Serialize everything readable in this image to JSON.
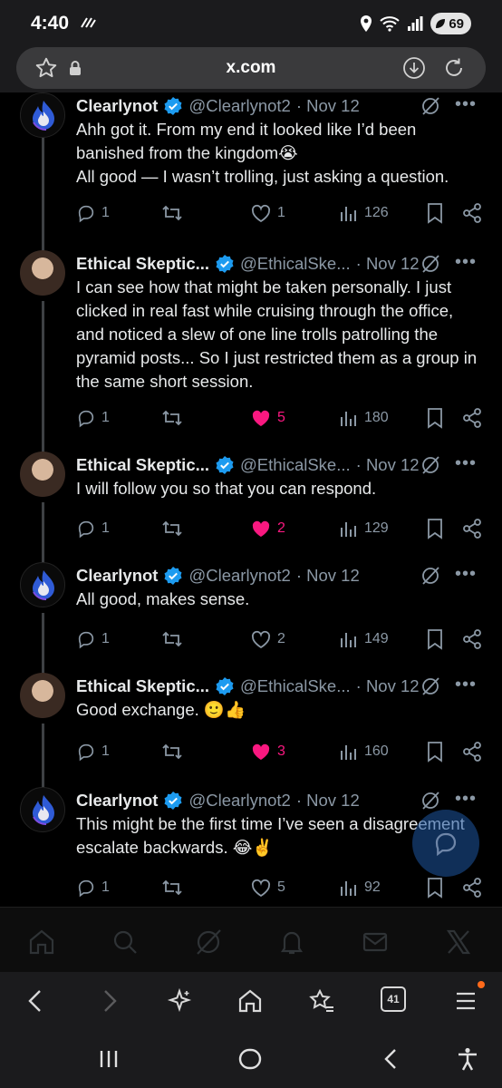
{
  "status": {
    "time": "4:40",
    "battery": "69"
  },
  "browser": {
    "url": "x.com",
    "tabs_count": "41"
  },
  "posts": [
    {
      "name": "Clearlynot",
      "handle": "@Clearlynot2",
      "date": "· Nov 12",
      "text": "Ahh got it. From my end it looked like I’d been banished from the kingdom😭\nAll good — I wasn’t trolling, just asking a question.",
      "replies": "1",
      "likes": "1",
      "liked": false,
      "views": "126"
    },
    {
      "name": "Ethical Skeptic...",
      "handle": "@EthicalSke...",
      "date": "· Nov 12",
      "text": "I can see how that might be taken personally. I just clicked in real fast while cruising through the office, and noticed a slew of one line trolls patrolling the pyramid posts... So I just restricted them as a group in the same short session.",
      "replies": "1",
      "likes": "5",
      "liked": true,
      "views": "180"
    },
    {
      "name": "Ethical Skeptic...",
      "handle": "@EthicalSke...",
      "date": "· Nov 12",
      "text": "I will follow you so that you can respond.",
      "replies": "1",
      "likes": "2",
      "liked": true,
      "views": "129"
    },
    {
      "name": "Clearlynot",
      "handle": "@Clearlynot2",
      "date": "· Nov 12",
      "text": "All good, makes sense.",
      "replies": "1",
      "likes": "2",
      "liked": false,
      "views": "149"
    },
    {
      "name": "Ethical Skeptic...",
      "handle": "@EthicalSke...",
      "date": "· Nov 12",
      "text": "Good exchange. 🙂👍",
      "replies": "1",
      "likes": "3",
      "liked": true,
      "views": "160"
    },
    {
      "name": "Clearlynot",
      "handle": "@Clearlynot2",
      "date": "· Nov 12",
      "text": "This might be the first time I’ve seen a disagreement escalate backwards. 😂✌️",
      "replies": "1",
      "likes": "5",
      "liked": false,
      "views": "92"
    }
  ],
  "colors": {
    "like": "#f91880",
    "verified": "#1d9bf0",
    "muted": "#8b98a5"
  }
}
